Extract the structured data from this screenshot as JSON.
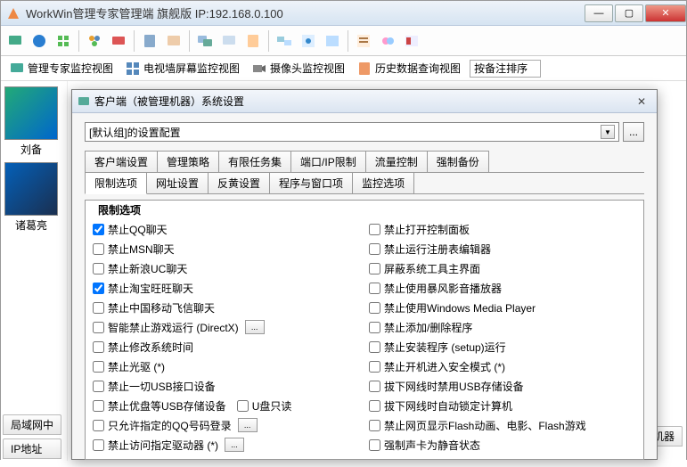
{
  "window": {
    "title": "WorkWin管理专家管理端   旗舰版 IP:192.168.0.100",
    "min": "—",
    "max": "▢",
    "close": "✕"
  },
  "viewbar": {
    "v1": "管理专家监控视图",
    "v2": "电视墙屏幕监控视图",
    "v3": "摄像头监控视图",
    "v4": "历史数据查询视图",
    "sort": "按备注排序"
  },
  "thumbs": {
    "t1": "刘备",
    "t2": "诸葛亮"
  },
  "bottom": {
    "b1": "局域网中",
    "b2": "IP地址",
    "right": "监视机器"
  },
  "dialog": {
    "title": "客户端（被管理机器）系统设置",
    "close": "✕",
    "combo_value": "[默认组]的设置配置",
    "dots": "...",
    "tabs_row1": [
      "客户端设置",
      "管理策略",
      "有限任务集",
      "端口/IP限制",
      "流量控制",
      "强制备份"
    ],
    "tabs_row2": [
      "限制选项",
      "网址设置",
      "反黄设置",
      "程序与窗口项",
      "监控选项"
    ],
    "group_title": "限制选项",
    "left_checks": [
      {
        "label": "禁止QQ聊天",
        "checked": true
      },
      {
        "label": "禁止MSN聊天",
        "checked": false
      },
      {
        "label": "禁止新浪UC聊天",
        "checked": false
      },
      {
        "label": "禁止淘宝旺旺聊天",
        "checked": true
      },
      {
        "label": "禁止中国移动飞信聊天",
        "checked": false
      },
      {
        "label": "智能禁止游戏运行 (DirectX)",
        "checked": false,
        "btn": true
      },
      {
        "label": "禁止修改系统时间",
        "checked": false
      },
      {
        "label": "禁止光驱 (*)",
        "checked": false
      },
      {
        "label": "禁止一切USB接口设备",
        "checked": false
      },
      {
        "label": "禁止优盘等USB存储设备",
        "checked": false,
        "extra_cb": "U盘只读"
      },
      {
        "label": "只允许指定的QQ号码登录",
        "checked": false,
        "btn": true
      },
      {
        "label": "禁止访问指定驱动器 (*)",
        "checked": false,
        "btn": true
      }
    ],
    "right_checks": [
      {
        "label": "禁止打开控制面板",
        "checked": false
      },
      {
        "label": "禁止运行注册表编辑器",
        "checked": false
      },
      {
        "label": "屏蔽系统工具主界面",
        "checked": false
      },
      {
        "label": "禁止使用暴风影音播放器",
        "checked": false
      },
      {
        "label": "禁止使用Windows Media Player",
        "checked": false
      },
      {
        "label": "禁止添加/删除程序",
        "checked": false
      },
      {
        "label": "禁止安装程序 (setup)运行",
        "checked": false
      },
      {
        "label": "禁止开机进入安全模式 (*)",
        "checked": false
      },
      {
        "label": "拔下网线时禁用USB存储设备",
        "checked": false
      },
      {
        "label": "拔下网线时自动锁定计算机",
        "checked": false
      },
      {
        "label": "禁止网页显示Flash动画、电影、Flash游戏",
        "checked": false
      },
      {
        "label": "强制声卡为静音状态",
        "checked": false
      }
    ]
  }
}
